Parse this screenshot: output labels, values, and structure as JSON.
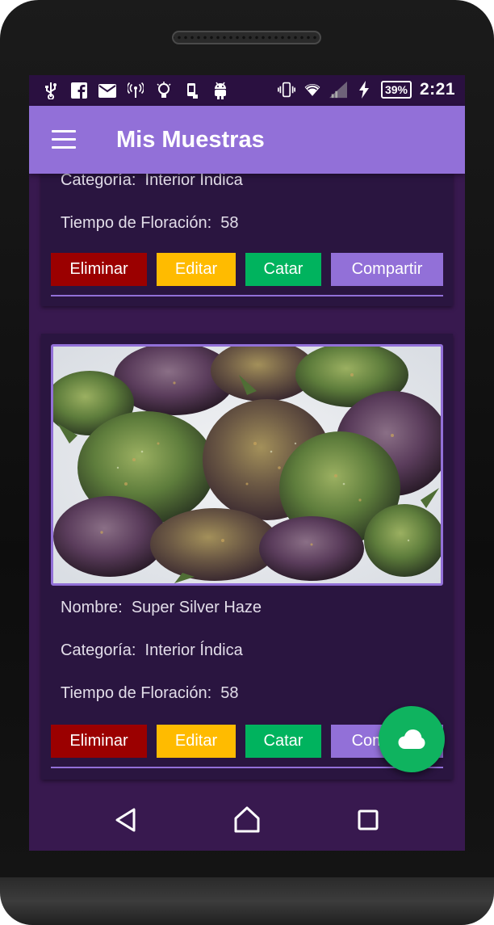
{
  "status_bar": {
    "left_icons": [
      "usb-icon",
      "facebook-icon",
      "mail-icon",
      "hotspot-icon",
      "lightbulb-icon",
      "phone-sync-icon",
      "android-icon"
    ],
    "right_icons": [
      "vibrate-icon",
      "wifi-icon",
      "signal-icon",
      "charging-icon"
    ],
    "battery": "39%",
    "time": "2:21"
  },
  "app_bar": {
    "title": "Mis Muestras",
    "menu_icon": "hamburger-menu-icon"
  },
  "samples": [
    {
      "category_label": "Categoría:",
      "category_value": "Interior Índica",
      "flowering_label": "Tiempo de Floración:",
      "flowering_value": "58"
    },
    {
      "name_label": "Nombre:",
      "name_value": "Super Silver Haze",
      "category_label": "Categoría:",
      "category_value": "Interior Índica",
      "flowering_label": "Tiempo de Floración:",
      "flowering_value": "58"
    }
  ],
  "actions": {
    "delete": "Eliminar",
    "edit": "Editar",
    "taste": "Catar",
    "share": "Compartir"
  },
  "fab": {
    "icon": "cloud-icon"
  },
  "nav": {
    "back_icon": "back-triangle-icon",
    "home_icon": "home-icon",
    "recents_icon": "recents-square-icon"
  },
  "colors": {
    "primary": "#9270d8",
    "status_bar": "#2a1040",
    "background": "#38194f",
    "card": "#2a1540",
    "delete": "#9b0000",
    "edit": "#ffbb00",
    "taste": "#00b35e",
    "fab": "#0fb35f"
  }
}
